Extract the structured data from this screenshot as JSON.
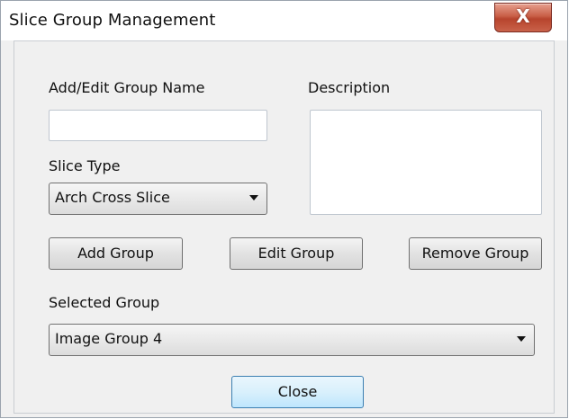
{
  "window": {
    "title": "Slice Group Management",
    "close_glyph": "X"
  },
  "form": {
    "group_name_label": "Add/Edit Group Name",
    "group_name_value": "",
    "description_label": "Description",
    "description_value": "",
    "slice_type_label": "Slice Type",
    "slice_type_value": "Arch Cross Slice",
    "selected_group_label": "Selected Group",
    "selected_group_value": "Image Group 4"
  },
  "buttons": {
    "add": "Add Group",
    "edit": "Edit Group",
    "remove": "Remove Group",
    "close": "Close"
  },
  "icons": {
    "close": "close-icon",
    "dropdown": "chevron-down-icon"
  },
  "colors": {
    "close_button": "#c85f47",
    "default_button_border": "#3c7fb1"
  }
}
